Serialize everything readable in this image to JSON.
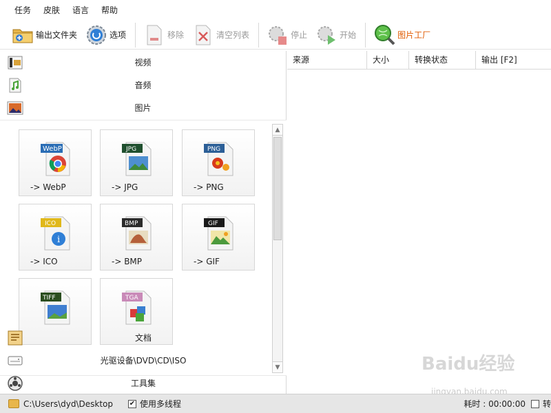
{
  "menubar": {
    "items": [
      "任务",
      "皮肤",
      "语言",
      "帮助"
    ]
  },
  "toolbar": {
    "output_folder": "输出文件夹",
    "options": "选项",
    "remove": "移除",
    "clear_list": "清空列表",
    "stop": "停止",
    "start": "开始",
    "picture_factory": "图片工厂"
  },
  "categories": {
    "video": "视频",
    "audio": "音频",
    "picture": "图片",
    "document": "文档",
    "optical": "光驱设备\\DVD\\CD\\ISO",
    "tools": "工具集"
  },
  "formats": [
    {
      "label": "-> WebP",
      "badge": "WebP",
      "badge_color": "#2a6db5"
    },
    {
      "label": "-> JPG",
      "badge": "JPG",
      "badge_color": "#1f4f2e"
    },
    {
      "label": "-> PNG",
      "badge": "PNG",
      "badge_color": "#2c5f97"
    },
    {
      "label": "-> ICO",
      "badge": "ICO",
      "badge_color": "#e0b81a"
    },
    {
      "label": "-> BMP",
      "badge": "BMP",
      "badge_color": "#2b2b2b"
    },
    {
      "label": "-> GIF",
      "badge": "GIF",
      "badge_color": "#1a1a1a"
    },
    {
      "label": "",
      "badge": "TIFF",
      "badge_color": "#2a4d1e"
    },
    {
      "label": "",
      "badge": "TGA",
      "badge_color": "#c98ab8"
    }
  ],
  "file_table": {
    "columns": [
      "来源",
      "大小",
      "转换状态",
      "输出 [F2]"
    ]
  },
  "statusbar": {
    "path": "C:\\Users\\dyd\\Desktop",
    "multithread_label": "使用多线程",
    "multithread_checked": "✔",
    "elapsed": "耗时 : 00:00:00",
    "trailing": "转"
  },
  "watermark": {
    "brand": "Baidu经验",
    "url": "jingyan.baidu.com"
  },
  "colors": {
    "accent_orange": "#e05a00",
    "disabled_text": "#9a9a9a",
    "statusbar_bg": "#e6e6e6"
  }
}
